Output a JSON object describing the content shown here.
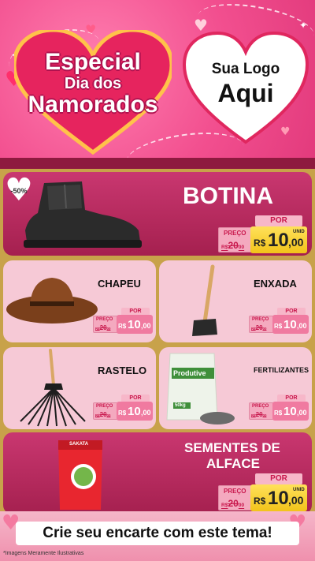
{
  "header": {
    "title_line1": "Especial",
    "title_line2": "Dia dos",
    "title_line3": "Namorados",
    "logo_line1": "Sua Logo",
    "logo_line2": "Aqui"
  },
  "featured": [
    {
      "name": "BOTINA",
      "discount": "-50%",
      "por": "POR",
      "preco_label": "PREÇO",
      "old_currency": "R$",
      "old_price": "20",
      "old_cents": "00",
      "currency": "R$",
      "price": "10",
      "cents": ",00",
      "unit": "UNID",
      "image": "boot"
    },
    {
      "name_line1": "SEMENTES DE",
      "name_line2": "ALFACE",
      "por": "POR",
      "preco_label": "PREÇO",
      "old_currency": "R$",
      "old_price": "20",
      "old_cents": "00",
      "currency": "R$",
      "price": "10",
      "cents": ",00",
      "unit": "UNID",
      "image": "seed-packet",
      "package_brand": "SAKATA"
    }
  ],
  "products": [
    {
      "name": "CHAPEU",
      "image": "hat",
      "por": "POR",
      "preco_label": "PREÇO",
      "old_currency": "R$",
      "old_price": "20",
      "old_cents": "00",
      "currency": "R$",
      "price": "10",
      "cents": ",00"
    },
    {
      "name": "ENXADA",
      "image": "hoe",
      "por": "POR",
      "preco_label": "PREÇO",
      "old_currency": "R$",
      "old_price": "20",
      "old_cents": "00",
      "currency": "R$",
      "price": "10",
      "cents": ",00"
    },
    {
      "name": "RASTELO",
      "image": "rake",
      "por": "POR",
      "preco_label": "PREÇO",
      "old_currency": "R$",
      "old_price": "20",
      "old_cents": "00",
      "currency": "R$",
      "price": "10",
      "cents": ",00"
    },
    {
      "name": "FERTILIZANTES",
      "image": "fertilizer-bag",
      "package_label": "Produtive",
      "package_weight": "50kg",
      "por": "POR",
      "preco_label": "PREÇO",
      "old_currency": "R$",
      "old_price": "20",
      "old_cents": "00",
      "currency": "R$",
      "price": "10",
      "cents": ",00"
    }
  ],
  "footer": {
    "cta": "Crie seu encarte com este tema!",
    "disclaimer": "*Imagens Meramente Ilustrativas"
  },
  "colors": {
    "header_pink": "#f24f8f",
    "card_magenta": "#b82a5c",
    "card_light": "#f6c9d6",
    "gold": "#c8a24a",
    "price_yellow": "#f2c31a",
    "price_red": "#c8174c"
  }
}
